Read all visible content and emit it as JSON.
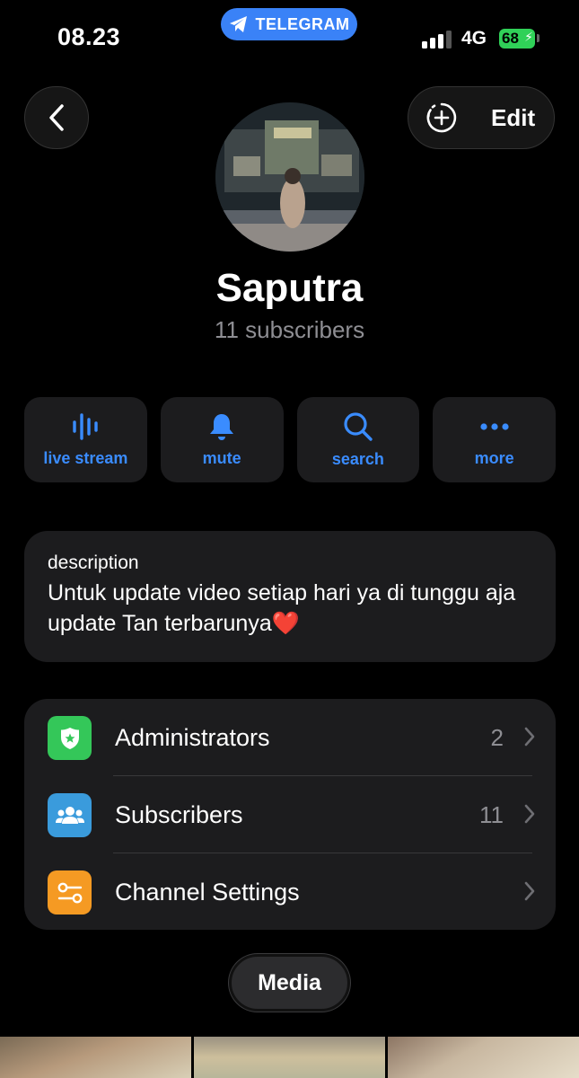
{
  "status_bar": {
    "time": "08.23",
    "app_pill": "TELEGRAM",
    "network": "4G",
    "battery": "68"
  },
  "header": {
    "back_icon": "chevron-left-icon",
    "add_story_icon": "add-story-icon",
    "edit_label": "Edit"
  },
  "profile": {
    "name": "Saputra",
    "subscribers": "11 subscribers"
  },
  "actions": [
    {
      "label": "live stream",
      "icon": "live-stream-icon"
    },
    {
      "label": "mute",
      "icon": "bell-icon"
    },
    {
      "label": "search",
      "icon": "search-icon"
    },
    {
      "label": "more",
      "icon": "more-icon"
    }
  ],
  "description": {
    "title": "description",
    "text": "Untuk update video setiap hari ya di tunggu aja update Tan terbarunya❤️"
  },
  "settings": [
    {
      "label": "Administrators",
      "count": "2",
      "icon": "admin-shield-icon",
      "color": "#34c759"
    },
    {
      "label": "Subscribers",
      "count": "11",
      "icon": "people-icon",
      "color": "#3a9bdc"
    },
    {
      "label": "Channel Settings",
      "count": "",
      "icon": "settings-toggles-icon",
      "color": "#f59a23"
    }
  ],
  "media_tab": {
    "label": "Media"
  },
  "colors": {
    "accent": "#3a8cff",
    "background": "#000000",
    "card": "#1c1c1e",
    "battery": "#30d158"
  }
}
